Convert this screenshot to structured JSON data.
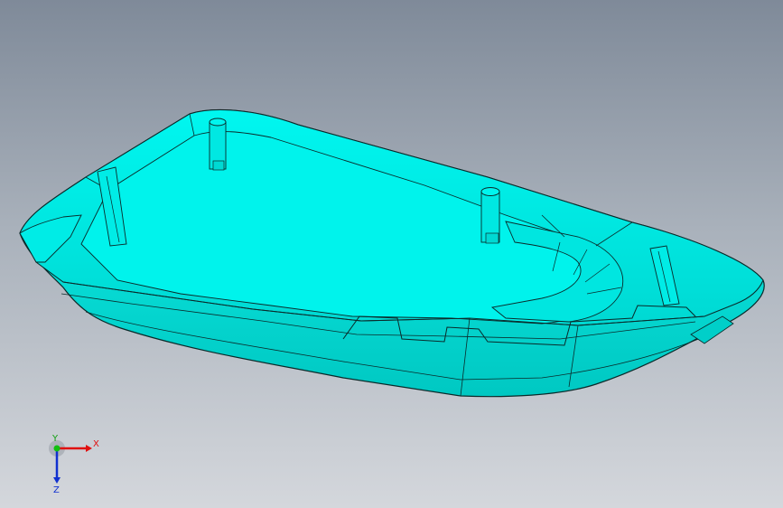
{
  "viewport": {
    "background_top": "#7f8a99",
    "background_bottom": "#d4d7dc",
    "part_color": "#00f5ee",
    "part_shadow_color": "#00cfc9",
    "edge_color": "#0a2a2a"
  },
  "triad": {
    "x_label": "X",
    "y_label": "Y",
    "z_label": "Z",
    "x_color": "#e01010",
    "y_color": "#10c010",
    "z_color": "#1030d0"
  }
}
